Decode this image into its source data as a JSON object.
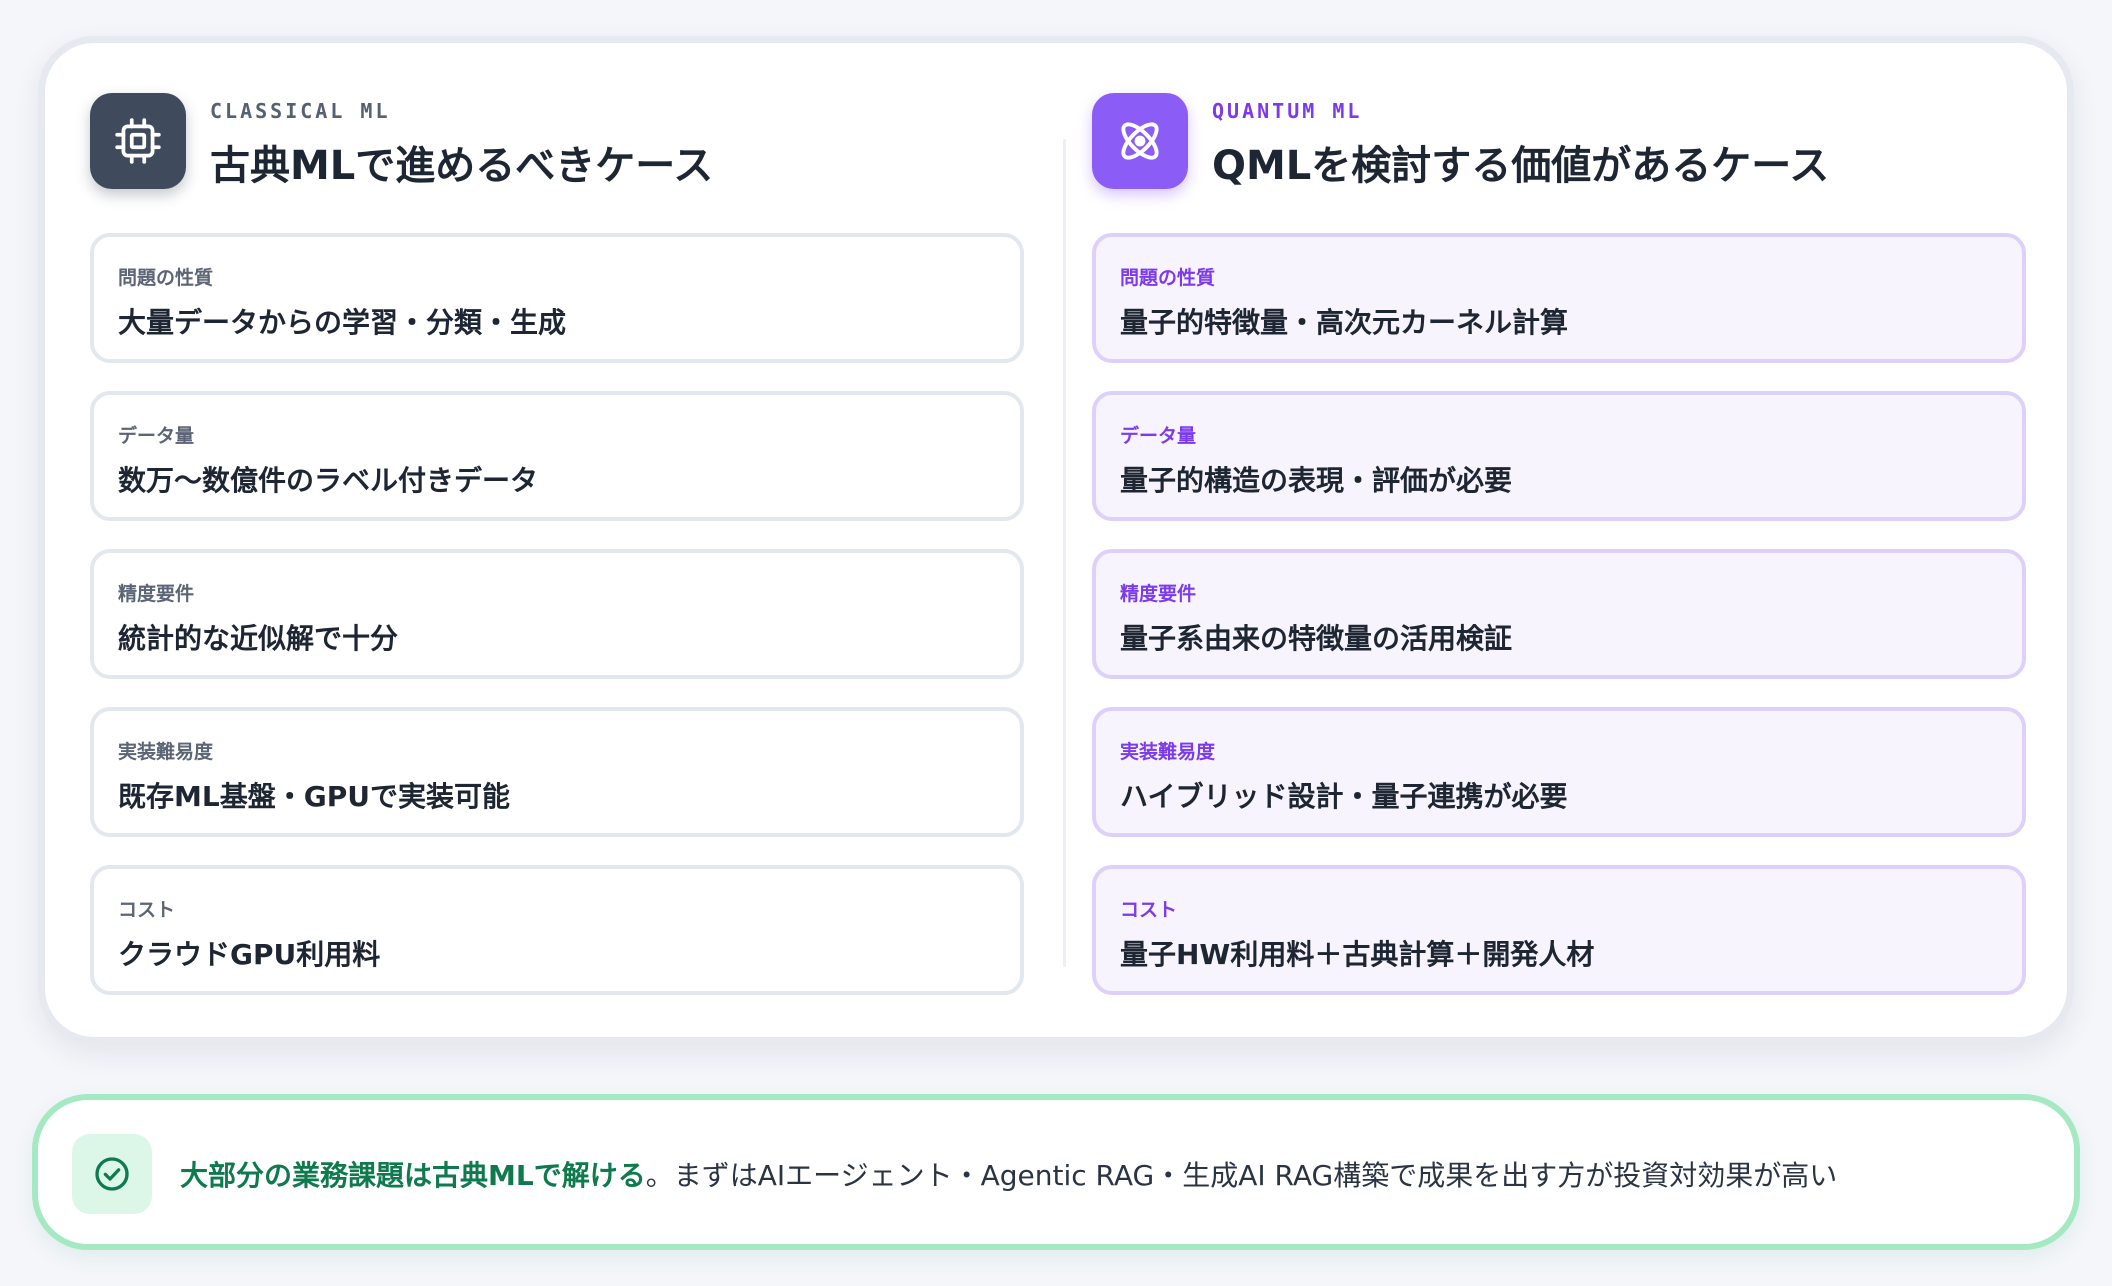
{
  "classical": {
    "kicker": "CLASSICAL ML",
    "title": "古典MLで進めるべきケース",
    "icon": "cpu-chip-icon",
    "rows": [
      {
        "label": "問題の性質",
        "value": "大量データからの学習・分類・生成"
      },
      {
        "label": "データ量",
        "value": "数万〜数億件のラベル付きデータ"
      },
      {
        "label": "精度要件",
        "value": "統計的な近似解で十分"
      },
      {
        "label": "実装難易度",
        "value": "既存ML基盤・GPUで実装可能"
      },
      {
        "label": "コスト",
        "value": "クラウドGPU利用料"
      }
    ]
  },
  "quantum": {
    "kicker": "QUANTUM ML",
    "title": "QMLを検討する価値があるケース",
    "icon": "atom-icon",
    "rows": [
      {
        "label": "問題の性質",
        "value": "量子的特徴量・高次元カーネル計算"
      },
      {
        "label": "データ量",
        "value": "量子的構造の表現・評価が必要"
      },
      {
        "label": "精度要件",
        "value": "量子系由来の特徴量の活用検証"
      },
      {
        "label": "実装難易度",
        "value": "ハイブリッド設計・量子連携が必要"
      },
      {
        "label": "コスト",
        "value": "量子HW利用料＋古典計算＋開発人材"
      }
    ]
  },
  "summary": {
    "icon": "check-circle-icon",
    "highlight": "大部分の業務課題は古典MLで解ける",
    "rest": "。まずはAIエージェント・Agentic RAG・生成AI RAG構築で成果を出す方が投資対効果が高い"
  },
  "colors": {
    "classical_accent": "#3f4a5c",
    "quantum_accent": "#8b5cf6",
    "success_accent": "#0f7a4e"
  }
}
